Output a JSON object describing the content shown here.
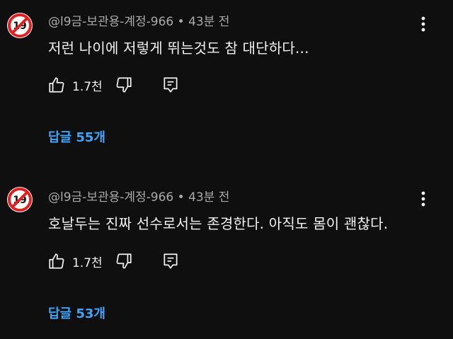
{
  "colors": {
    "background": "#0f0f0f",
    "text_primary": "#f1f1f1",
    "text_secondary": "#aaaaaa",
    "link": "#3ea6ff",
    "badge_red": "#e02020"
  },
  "comments": [
    {
      "avatar_badge": "19",
      "author": "@l9금-보관용-계정-966",
      "separator": " • ",
      "time": "43분 전",
      "text": "저런 나이에 저렇게 뛰는것도 참 대단하다...",
      "likes": "1.7천",
      "replies_label": "답글 55개",
      "icons": [
        "thumb-up-icon",
        "thumb-down-icon",
        "reply-icon",
        "more-vert-icon"
      ]
    },
    {
      "avatar_badge": "19",
      "author": "@l9금-보관용-계정-966",
      "separator": " • ",
      "time": "43분 전",
      "text": "호날두는 진짜 선수로서는 존경한다. 아직도 몸이 괜찮다.",
      "likes": "1.7천",
      "replies_label": "답글 53개",
      "icons": [
        "thumb-up-icon",
        "thumb-down-icon",
        "reply-icon",
        "more-vert-icon"
      ]
    }
  ]
}
